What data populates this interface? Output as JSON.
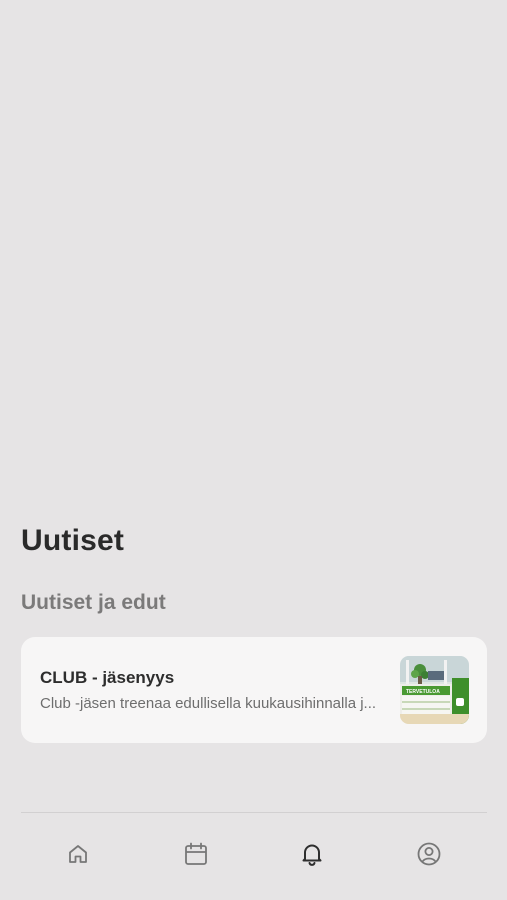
{
  "page": {
    "title": "Uutiset",
    "section_title": "Uutiset ja edut"
  },
  "news": [
    {
      "title": "CLUB - jäsenyys",
      "description": "Club -jäsen treenaa edullisella kuukausihinnalla j...",
      "thumbnail_text": "TERVETULOA"
    }
  ],
  "tabbar": {
    "items": [
      {
        "icon": "home-icon",
        "active": false
      },
      {
        "icon": "calendar-icon",
        "active": false
      },
      {
        "icon": "bell-icon",
        "active": true
      },
      {
        "icon": "profile-icon",
        "active": false
      }
    ]
  },
  "colors": {
    "background": "#e6e4e5",
    "card": "#f7f6f6",
    "active_icon": "#2e2e2e",
    "inactive_icon": "#777777",
    "brand_green": "#3f9b2f"
  }
}
